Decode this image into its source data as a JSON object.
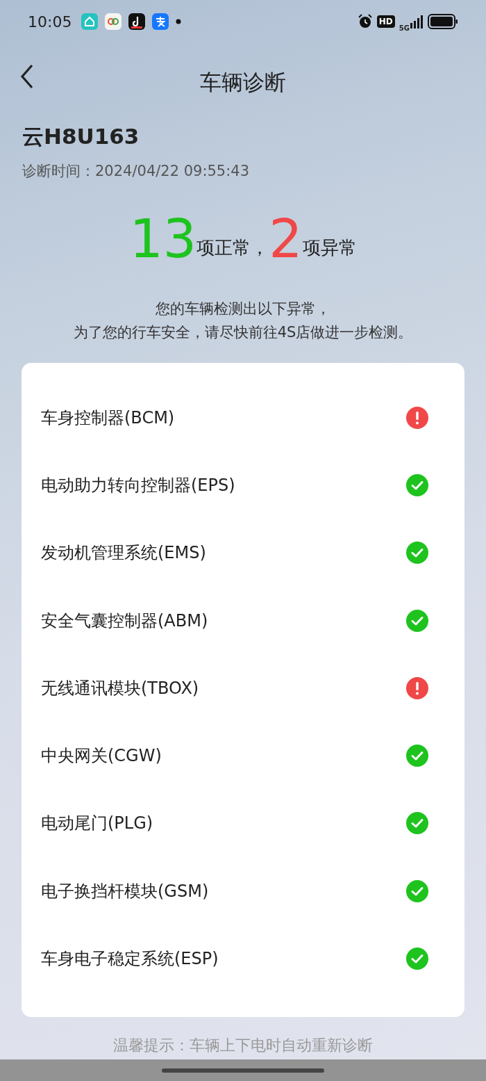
{
  "status_bar": {
    "time": "10:05",
    "hd": "HD",
    "network": "5G"
  },
  "header": {
    "title": "车辆诊断"
  },
  "vehicle": {
    "plate": "云H8U163",
    "time_label": "诊断时间：",
    "time": "2024/04/22 09:55:43"
  },
  "summary": {
    "normal_count": "13",
    "normal_label": "项正常，",
    "abnormal_count": "2",
    "abnormal_label": "项异常"
  },
  "message": [
    "您的车辆检测出以下异常，",
    "为了您的行车安全，请尽快前往4S店做进一步检测。"
  ],
  "items": [
    {
      "name": "车身控制器(BCM)",
      "abnormal": true
    },
    {
      "name": "电动助力转向控制器(EPS)",
      "abnormal": false
    },
    {
      "name": "发动机管理系统(EMS)",
      "abnormal": false
    },
    {
      "name": "安全气囊控制器(ABM)",
      "abnormal": false
    },
    {
      "name": "无线通讯模块(TBOX)",
      "abnormal": true
    },
    {
      "name": "中央网关(CGW)",
      "abnormal": false
    },
    {
      "name": "电动尾门(PLG)",
      "abnormal": false
    },
    {
      "name": "电子换挡杆模块(GSM)",
      "abnormal": false
    },
    {
      "name": "车身电子稳定系统(ESP)",
      "abnormal": false
    }
  ],
  "footer": {
    "tip": "温馨提示：车辆上下电时自动重新诊断"
  }
}
